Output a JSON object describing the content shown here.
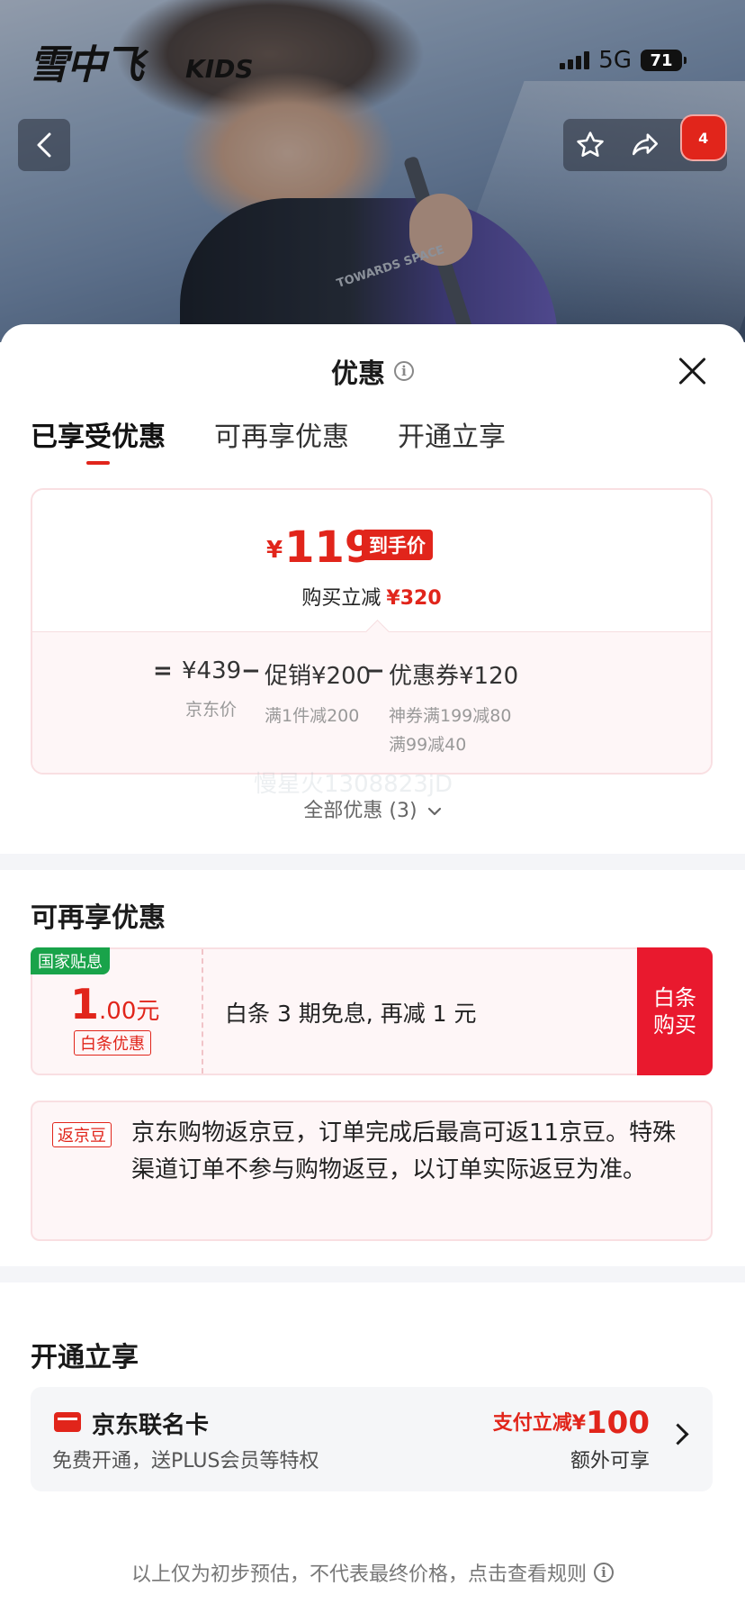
{
  "status_bar": {
    "network": "5G",
    "battery": "71"
  },
  "hero": {
    "brand": "雪中飞",
    "brand_sub": "KIDS",
    "jacket_print": "TOWARDS SPACE",
    "badge_count": "4"
  },
  "sheet": {
    "title": "优惠",
    "tabs": [
      {
        "label": "已享受优惠"
      },
      {
        "label": "可再享优惠"
      },
      {
        "label": "开通立享"
      }
    ],
    "price_card": {
      "currency": "¥",
      "final_price": "119",
      "price_tag": "到手价",
      "reduce_label": "购买立减",
      "reduce_value": "¥320",
      "formula": {
        "equals": "=",
        "jd_price": "¥439",
        "jd_price_label": "京东价",
        "minus1": "−",
        "promo": "促销¥200",
        "promo_note": "满1件减200",
        "minus2": "−",
        "coupon": "优惠券¥120",
        "coupon_note1": "神券满199减80",
        "coupon_note2": "满99减40"
      }
    },
    "watermark": "慢星火1308823jD",
    "all_discount": "全部优惠 (3)"
  },
  "more_section": {
    "title": "可再享优惠",
    "coupon": {
      "gov_tag": "国家贴息",
      "amount_big": "1",
      "amount_small": ".00元",
      "tag": "白条优惠",
      "desc": "白条 3 期免息, 再减 1 元",
      "buy_label": "白条\n购买"
    },
    "bean": {
      "tag": "返京豆",
      "text": "京东购物返京豆，订单完成后最高可返11京豆。特殊渠道订单不参与购物返豆，以订单实际返豆为准。"
    }
  },
  "open_section": {
    "title": "开通立享",
    "card": {
      "name": "京东联名卡",
      "sub": "免费开通，送PLUS会员等特权",
      "offer_label": "支付立减¥",
      "offer_value": "100",
      "offer_note": "额外可享"
    }
  },
  "footer": {
    "text": "以上仅为初步预估，不代表最终价格，点击查看规则"
  },
  "colors": {
    "accent": "#e1251b",
    "green_tag": "#19a34a",
    "card_bg": "#fef6f7"
  }
}
